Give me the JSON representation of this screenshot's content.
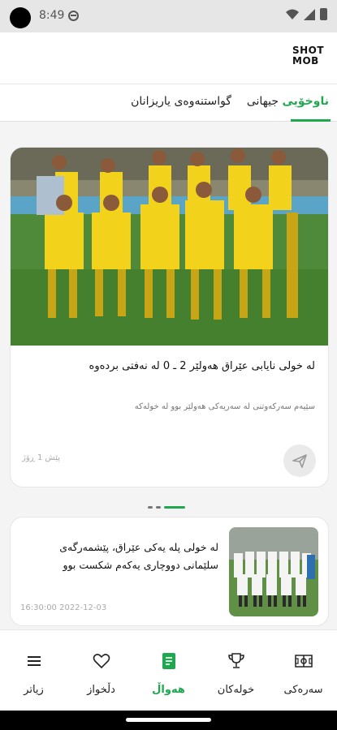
{
  "status_bar": {
    "time": "8:49"
  },
  "app": {
    "logo_line1": "SHOT",
    "logo_line2": "MOB"
  },
  "tabs": [
    {
      "label": "ناوخۆیی",
      "active": true
    },
    {
      "label": "جیهانی",
      "active": false
    },
    {
      "label": "گواستنەوەی یاریزانان",
      "active": false
    }
  ],
  "featured": {
    "title": "لە خولی نایابی عێراق هەولێر 2 ـ 0 لە نەفتی بردەوە",
    "subtitle": "سێیەم سەرکەوتنی لە سەریەکی هەولێر بوو لە خولەکە",
    "time": "پێش 1 ڕۆژ"
  },
  "news_item": {
    "title": "لە خولی پلە یەکی عێراق، پێشمەرگەی سلێمانی دووچاری یەکەم شکست بوو",
    "time": "16:30:00 2022-12-03"
  },
  "bottom_nav": [
    {
      "label": "سەرەکی",
      "icon": "pitch-icon",
      "active": false
    },
    {
      "label": "خولەکان",
      "icon": "trophy-icon",
      "active": false
    },
    {
      "label": "هەواڵ",
      "icon": "news-icon",
      "active": true
    },
    {
      "label": "دڵخواز",
      "icon": "heart-icon",
      "active": false
    },
    {
      "label": "زیاتر",
      "icon": "menu-icon",
      "active": false
    }
  ],
  "colors": {
    "accent": "#1fa84f",
    "team_kit": "#f2d21b"
  }
}
